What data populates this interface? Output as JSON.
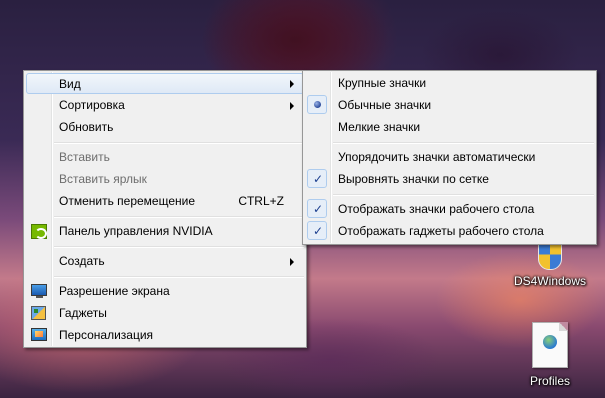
{
  "context_menu": {
    "items": [
      {
        "label": "Вид",
        "submenu": true,
        "highlighted": true
      },
      {
        "label": "Сортировка",
        "submenu": true
      },
      {
        "label": "Обновить"
      },
      {
        "label": "Вставить",
        "disabled": true
      },
      {
        "label": "Вставить ярлык",
        "disabled": true
      },
      {
        "label": "Отменить перемещение",
        "shortcut": "CTRL+Z"
      },
      {
        "label": "Панель управления NVIDIA",
        "icon": "nvidia-icon"
      },
      {
        "label": "Создать",
        "submenu": true
      },
      {
        "label": "Разрешение экрана",
        "icon": "monitor-icon"
      },
      {
        "label": "Гаджеты",
        "icon": "gadget-icon"
      },
      {
        "label": "Персонализация",
        "icon": "personalization-icon"
      }
    ]
  },
  "view_submenu": {
    "items": [
      {
        "label": "Крупные значки"
      },
      {
        "label": "Обычные значки",
        "selected": "radio"
      },
      {
        "label": "Мелкие значки"
      },
      {
        "label": "Упорядочить значки автоматически"
      },
      {
        "label": "Выровнять значки по сетке",
        "checked": true
      },
      {
        "label": "Отображать значки рабочего стола",
        "checked": true
      },
      {
        "label": "Отображать гаджеты  рабочего стола",
        "checked": true
      }
    ]
  },
  "desktop_icons": [
    {
      "label": "DS4Windows",
      "icon": "shield-icon"
    },
    {
      "label": "Profiles",
      "icon": "document-icon"
    }
  ],
  "colors": {
    "menu_background": "#f0f0f0",
    "highlight_border": "#aeccee",
    "disabled_text": "#6d6d6d"
  }
}
